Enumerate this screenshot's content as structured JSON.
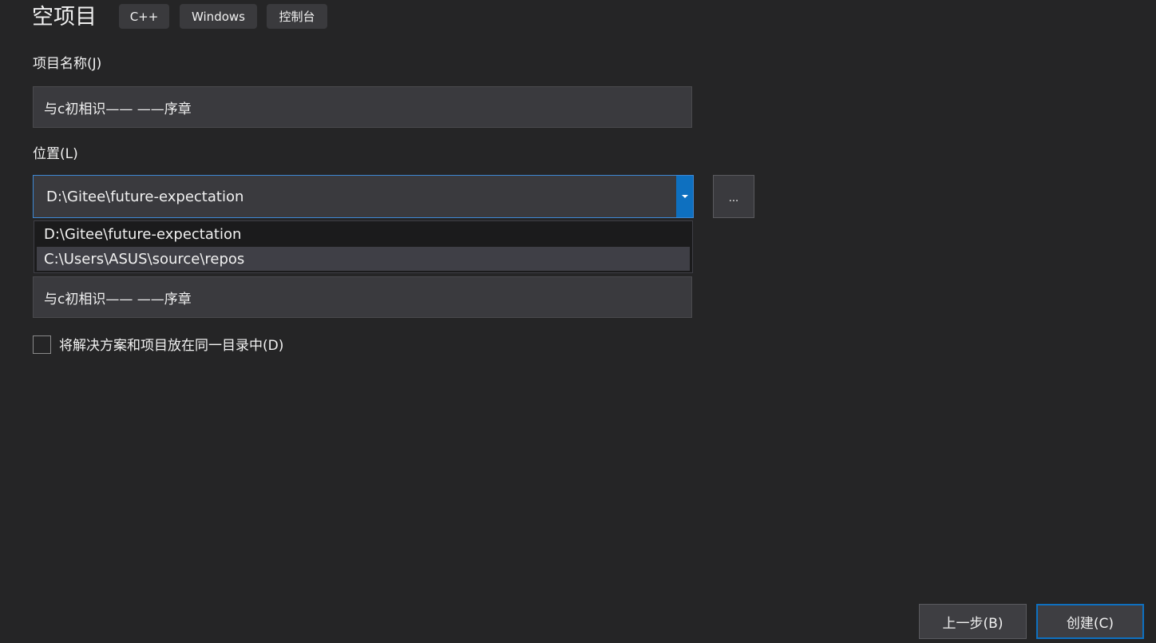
{
  "header": {
    "title": "空项目",
    "tags": [
      "C++",
      "Windows",
      "控制台"
    ]
  },
  "project_name": {
    "label": "项目名称(J)",
    "value": "与c初相识—— ——序章"
  },
  "location": {
    "label": "位置(L)",
    "value": "D:\\Gitee\\future-expectation",
    "browse_label": "...",
    "options": [
      "D:\\Gitee\\future-expectation",
      "C:\\Users\\ASUS\\source\\repos"
    ],
    "highlighted_index": 1
  },
  "solution_name": {
    "value": "与c初相识—— ——序章"
  },
  "same_directory": {
    "label": "将解决方案和项目放在同一目录中(D)",
    "checked": false
  },
  "footer": {
    "back_label": "上一步(B)",
    "create_label": "创建(C)"
  },
  "colors": {
    "background": "#252526",
    "accent": "#0e70c0",
    "input_bg": "#3a3a3e"
  }
}
